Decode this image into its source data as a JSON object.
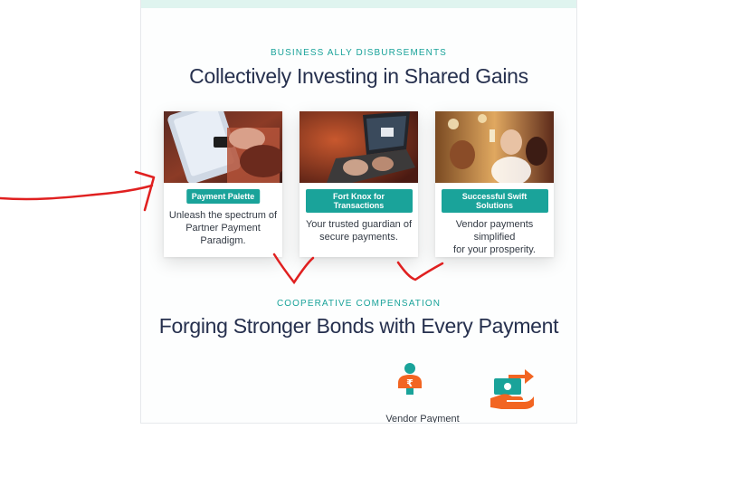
{
  "section1": {
    "eyebrow": "BUSINESS ALLY DISBURSEMENTS",
    "title": "Collectively Investing in Shared Gains"
  },
  "cards": [
    {
      "badge": "Payment Palette",
      "text_line1": "Unleash the spectrum of",
      "text_line2": "Partner Payment Paradigm."
    },
    {
      "badge": "Fort Knox for Transactions",
      "text_line1": "Your trusted guardian of",
      "text_line2": "secure payments."
    },
    {
      "badge": "Successful Swift Solutions",
      "text_line1": "Vendor payments simplified",
      "text_line2": "for your prosperity."
    }
  ],
  "section2": {
    "eyebrow": "COOPERATIVE COMPENSATION",
    "title": "Forging Stronger Bonds with Every Payment"
  },
  "features": [
    {
      "icon": "vendor-payment-icon",
      "label": "Vendor Payment"
    },
    {
      "icon": "cash-transfer-icon",
      "label": ""
    }
  ],
  "colors": {
    "accent_teal": "#1aa39a",
    "accent_orange": "#f26522",
    "heading_navy": "#26304e",
    "annotation_red": "#e02020"
  }
}
